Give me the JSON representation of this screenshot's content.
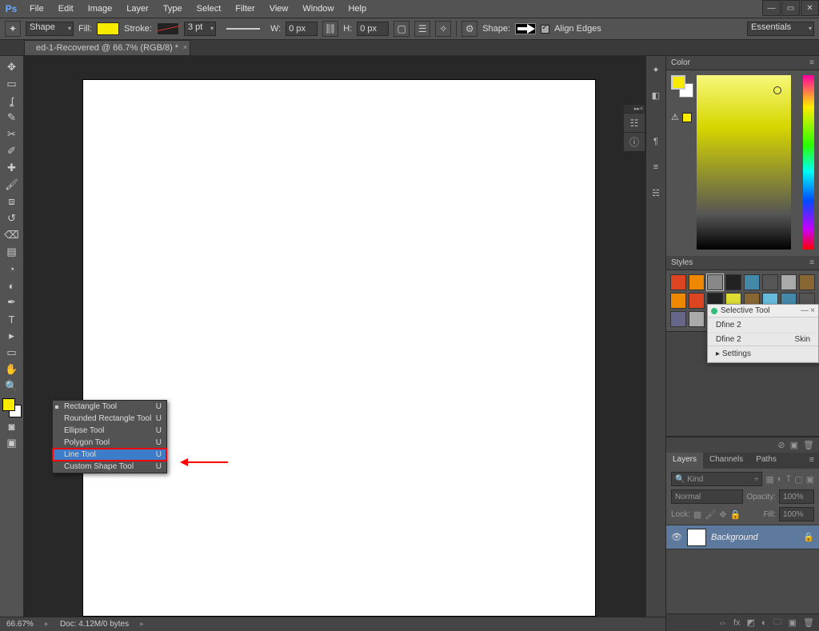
{
  "menu": {
    "items": [
      "File",
      "Edit",
      "Image",
      "Layer",
      "Type",
      "Select",
      "Filter",
      "View",
      "Window",
      "Help"
    ],
    "logo": "Ps"
  },
  "options": {
    "mode": "Shape",
    "fill_label": "Fill:",
    "stroke_label": "Stroke:",
    "stroke_pt": "3 pt",
    "w_label": "W:",
    "w_val": "0 px",
    "h_label": "H:",
    "h_val": "0 px",
    "shape_label": "Shape:",
    "align_label": "Align Edges",
    "workspace": "Essentials"
  },
  "doc": {
    "title": "ed-1-Recovered @ 66.7% (RGB/8) *"
  },
  "flyout": {
    "items": [
      {
        "label": "Rectangle Tool",
        "key": "U"
      },
      {
        "label": "Rounded Rectangle Tool",
        "key": "U"
      },
      {
        "label": "Ellipse Tool",
        "key": "U"
      },
      {
        "label": "Polygon Tool",
        "key": "U"
      },
      {
        "label": "Line Tool",
        "key": "U",
        "hl": true
      },
      {
        "label": "Custom Shape Tool",
        "key": "U"
      }
    ]
  },
  "panels": {
    "color_title": "Color",
    "styles_title": "Styles",
    "sel_title": "Selective Tool",
    "sel_name": "Dfine 2",
    "sel_row1": "Dfine 2",
    "sel_row2": "Skin",
    "sel_settings": "Settings",
    "layers_tabs": [
      "Layers",
      "Channels",
      "Paths"
    ],
    "kind": "Kind",
    "blend": "Normal",
    "opacity_label": "Opacity:",
    "opacity": "100%",
    "lock_label": "Lock:",
    "fill_label": "Fill:",
    "fill": "100%",
    "layer_name": "Background"
  },
  "status": {
    "zoom": "66.67%",
    "doc": "Doc: 4.12M/0 bytes"
  },
  "colors": {
    "fill": "#f8ea00"
  }
}
